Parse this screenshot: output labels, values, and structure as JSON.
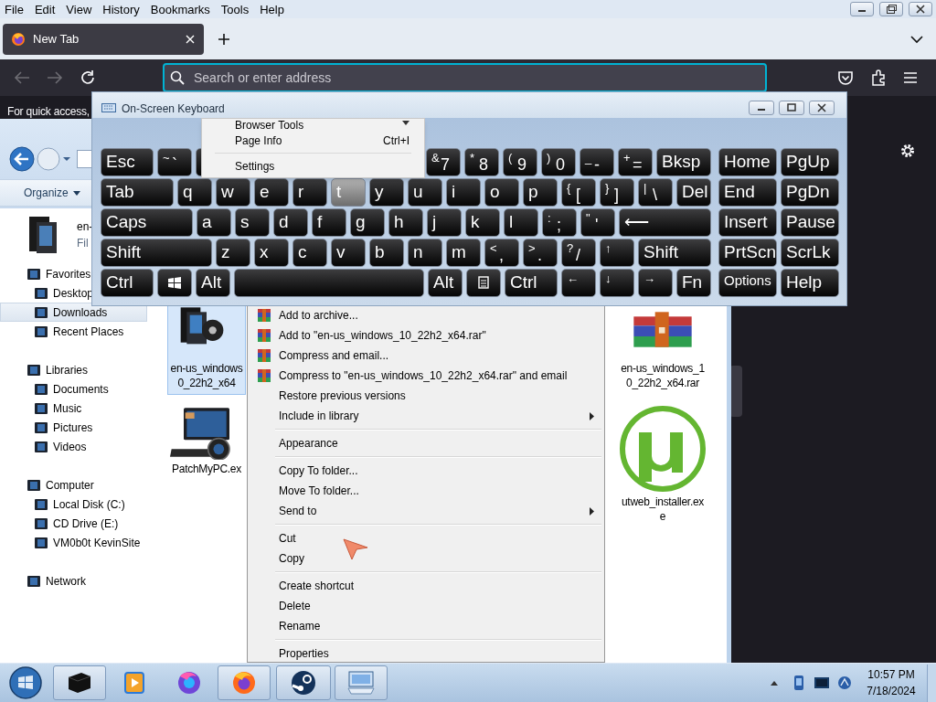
{
  "firefox": {
    "menu": [
      "File",
      "Edit",
      "View",
      "History",
      "Bookmarks",
      "Tools",
      "Help"
    ],
    "tabs": [
      {
        "title": "New Tab",
        "selected": true
      }
    ],
    "address": {
      "placeholder": "Search or enter address",
      "focused": true
    },
    "page_text": "For quick access,",
    "app_menu": [
      {
        "label": "Browser Tools",
        "kind": "submenu"
      },
      {
        "label": "Page Info",
        "shortcut": "Ctrl+I",
        "kind": "item"
      },
      {
        "kind": "separator"
      },
      {
        "label": "Settings",
        "kind": "item"
      }
    ]
  },
  "explorer": {
    "organize": "Organize",
    "details": {
      "title": "en-",
      "subtitle": "Fil"
    },
    "nav": [
      {
        "label": "Favorites",
        "selected": false,
        "children": [
          {
            "label": "Desktop",
            "selected": false
          },
          {
            "label": "Downloads",
            "selected": true
          },
          {
            "label": "Recent Places",
            "selected": false
          }
        ]
      },
      {
        "label": "Libraries",
        "selected": false,
        "children": [
          {
            "label": "Documents",
            "selected": false
          },
          {
            "label": "Music",
            "selected": false
          },
          {
            "label": "Pictures",
            "selected": false
          },
          {
            "label": "Videos",
            "selected": false
          }
        ]
      },
      {
        "label": "Computer",
        "selected": false,
        "children": [
          {
            "label": "Local Disk (C:)",
            "selected": false
          },
          {
            "label": "CD Drive (E:)",
            "selected": false
          },
          {
            "label": "VM0b0t KevinSite",
            "selected": false
          }
        ]
      },
      {
        "label": "Network",
        "selected": false
      }
    ],
    "files": [
      {
        "lines": [
          "en-us_windows",
          "0_22h2_x64"
        ],
        "kind": "disc",
        "selected": true
      },
      {
        "lines": [
          "PatchMyPC.ex"
        ],
        "kind": "computer",
        "selected": false
      },
      {
        "lines": [
          "en-us_windows_1",
          "0_22h2_x64.rar"
        ],
        "kind": "archive",
        "selected": false
      },
      {
        "lines": [
          "utweb_installer.ex",
          "e"
        ],
        "kind": "mu",
        "selected": false
      }
    ]
  },
  "context_menu": [
    {
      "kind": "item",
      "label": "Add to archive...",
      "archive_icon": true,
      "submenu": false
    },
    {
      "kind": "item",
      "label": "Add to \"en-us_windows_10_22h2_x64.rar\"",
      "archive_icon": true,
      "submenu": false
    },
    {
      "kind": "item",
      "label": "Compress and email...",
      "archive_icon": true,
      "submenu": false
    },
    {
      "kind": "item",
      "label": "Compress to \"en-us_windows_10_22h2_x64.rar\" and email",
      "archive_icon": true,
      "submenu": false
    },
    {
      "kind": "item",
      "label": "Restore previous versions",
      "archive_icon": false,
      "submenu": false
    },
    {
      "kind": "item",
      "label": "Include in library",
      "archive_icon": false,
      "submenu": true
    },
    {
      "kind": "separator"
    },
    {
      "kind": "item",
      "label": "Appearance",
      "archive_icon": false,
      "submenu": false
    },
    {
      "kind": "separator"
    },
    {
      "kind": "item",
      "label": "Copy To folder...",
      "archive_icon": false,
      "submenu": false
    },
    {
      "kind": "item",
      "label": "Move To folder...",
      "archive_icon": false,
      "submenu": false
    },
    {
      "kind": "item",
      "label": "Send to",
      "archive_icon": false,
      "submenu": true
    },
    {
      "kind": "separator"
    },
    {
      "kind": "item",
      "label": "Cut",
      "archive_icon": false,
      "submenu": false
    },
    {
      "kind": "item",
      "label": "Copy",
      "archive_icon": false,
      "submenu": false
    },
    {
      "kind": "separator"
    },
    {
      "kind": "item",
      "label": "Create shortcut",
      "archive_icon": false,
      "submenu": false
    },
    {
      "kind": "item",
      "label": "Delete",
      "archive_icon": false,
      "submenu": false
    },
    {
      "kind": "item",
      "label": "Rename",
      "archive_icon": false,
      "submenu": false
    },
    {
      "kind": "separator"
    },
    {
      "kind": "item",
      "label": "Properties",
      "archive_icon": false,
      "submenu": false
    }
  ],
  "osk": {
    "title": "On-Screen Keyboard",
    "rows": [
      {
        "keys": [
          {
            "kind": "mod",
            "label": "Esc",
            "pressed": false
          },
          {
            "kind": "key",
            "shift": "~",
            "label": "`",
            "pressed": false
          },
          {
            "kind": "key",
            "pressed": false
          },
          {
            "kind": "key"
          },
          {
            "kind": "key"
          },
          {
            "kind": "key"
          },
          {
            "kind": "key"
          },
          {
            "kind": "key"
          },
          {
            "kind": "key",
            "shift": "&",
            "label": "7",
            "pressed": false
          },
          {
            "kind": "key",
            "shift": "*",
            "label": "8",
            "pressed": false
          },
          {
            "kind": "key",
            "shift": "(",
            "label": "9",
            "pressed": false
          },
          {
            "kind": "key",
            "shift": ")",
            "label": "0",
            "pressed": false
          },
          {
            "kind": "key",
            "shift": "_",
            "label": "-",
            "pressed": false
          },
          {
            "kind": "key",
            "shift": "+",
            "label": "=",
            "pressed": false
          },
          {
            "kind": "wide",
            "label": "Bksp",
            "pressed": false
          }
        ],
        "side": [
          {
            "label": "Home",
            "pressed": false
          },
          {
            "label": "PgUp",
            "pressed": false
          }
        ]
      },
      {
        "keys": [
          {
            "kind": "wide",
            "label": "Tab",
            "pressed": false
          },
          {
            "kind": "key",
            "label": "q",
            "pressed": false
          },
          {
            "kind": "key",
            "label": "w",
            "pressed": false
          },
          {
            "kind": "key",
            "label": "e",
            "pressed": false
          },
          {
            "kind": "key",
            "label": "r",
            "pressed": false
          },
          {
            "kind": "key",
            "label": "t",
            "pressed": true
          },
          {
            "kind": "key",
            "label": "y",
            "pressed": false
          },
          {
            "kind": "key",
            "label": "u",
            "pressed": false
          },
          {
            "kind": "key",
            "label": "i",
            "pressed": false
          },
          {
            "kind": "key",
            "label": "o",
            "pressed": false
          },
          {
            "kind": "key",
            "label": "p",
            "pressed": false
          },
          {
            "kind": "key",
            "shift": "{",
            "label": "[",
            "pressed": false
          },
          {
            "kind": "key",
            "shift": "}",
            "label": "]",
            "pressed": false
          },
          {
            "kind": "key",
            "shift": "|",
            "label": "\\",
            "pressed": false
          },
          {
            "kind": "key",
            "label": "Del",
            "pressed": false
          }
        ],
        "side": [
          {
            "label": "End",
            "pressed": false
          },
          {
            "label": "PgDn",
            "pressed": false
          }
        ]
      },
      {
        "keys": [
          {
            "kind": "wide",
            "label": "Caps",
            "pressed": false
          },
          {
            "kind": "key",
            "label": "a",
            "pressed": false
          },
          {
            "kind": "key",
            "label": "s",
            "pressed": false
          },
          {
            "kind": "key",
            "label": "d",
            "pressed": false
          },
          {
            "kind": "key",
            "label": "f",
            "pressed": false
          },
          {
            "kind": "key",
            "label": "g",
            "pressed": false
          },
          {
            "kind": "key",
            "label": "h",
            "pressed": false
          },
          {
            "kind": "key",
            "label": "j",
            "pressed": false
          },
          {
            "kind": "key",
            "label": "k",
            "pressed": false
          },
          {
            "kind": "key",
            "label": "l",
            "pressed": false
          },
          {
            "kind": "key",
            "shift": ":",
            "label": ";",
            "pressed": false
          },
          {
            "kind": "key",
            "shift": "\"",
            "label": "'",
            "pressed": false
          },
          {
            "kind": "wide",
            "label": "⟵",
            "pressed": false
          }
        ],
        "side": [
          {
            "label": "Insert",
            "pressed": false
          },
          {
            "label": "Pause",
            "pressed": false
          }
        ]
      },
      {
        "keys": [
          {
            "kind": "wide",
            "label": "Shift",
            "pressed": false
          },
          {
            "kind": "key",
            "label": "z",
            "pressed": false
          },
          {
            "kind": "key",
            "label": "x",
            "pressed": false
          },
          {
            "kind": "key",
            "label": "c",
            "pressed": false
          },
          {
            "kind": "key",
            "label": "v",
            "pressed": false
          },
          {
            "kind": "key",
            "label": "b",
            "pressed": false
          },
          {
            "kind": "key",
            "label": "n",
            "pressed": false
          },
          {
            "kind": "key",
            "label": "m",
            "pressed": false
          },
          {
            "kind": "key",
            "shift": "<",
            "label": ",",
            "pressed": false
          },
          {
            "kind": "key",
            "shift": ">",
            "label": ".",
            "pressed": false
          },
          {
            "kind": "key",
            "shift": "?",
            "label": "/",
            "pressed": false
          },
          {
            "kind": "key",
            "shift": "↑",
            "pressed": false
          },
          {
            "kind": "mid",
            "label": "Shift",
            "pressed": false
          }
        ],
        "side": [
          {
            "label": "PrtScn",
            "pressed": false
          },
          {
            "label": "ScrLk",
            "pressed": false
          }
        ]
      },
      {
        "keys": [
          {
            "kind": "mod",
            "label": "Ctrl",
            "pressed": false
          },
          {
            "kind": "win",
            "pressed": false
          },
          {
            "kind": "key",
            "label": "Alt",
            "pressed": false
          },
          {
            "kind": "wide",
            "pressed": false
          },
          {
            "kind": "key",
            "label": "Alt",
            "pressed": false
          },
          {
            "kind": "menu",
            "pressed": false
          },
          {
            "kind": "mod",
            "label": "Ctrl",
            "pressed": false
          },
          {
            "kind": "key",
            "shift": "←",
            "pressed": false
          },
          {
            "kind": "key",
            "shift": "↓",
            "pressed": false
          },
          {
            "kind": "key",
            "shift": "→",
            "pressed": false
          },
          {
            "kind": "key",
            "label": "Fn",
            "pressed": false
          }
        ],
        "side": [
          {
            "label": "Options",
            "pressed": false
          },
          {
            "label": "Help",
            "pressed": false
          }
        ]
      }
    ]
  },
  "taskbar": {
    "apps": [
      {
        "kind": "explorer",
        "running": true
      },
      {
        "kind": "player",
        "running": false
      },
      {
        "kind": "browser-dev",
        "running": false
      },
      {
        "kind": "browser",
        "running": true
      },
      {
        "kind": "steam",
        "running": true
      },
      {
        "kind": "keyboard",
        "running": true
      }
    ],
    "clock": {
      "time": "10:57 PM",
      "date": "7/18/2024"
    }
  }
}
